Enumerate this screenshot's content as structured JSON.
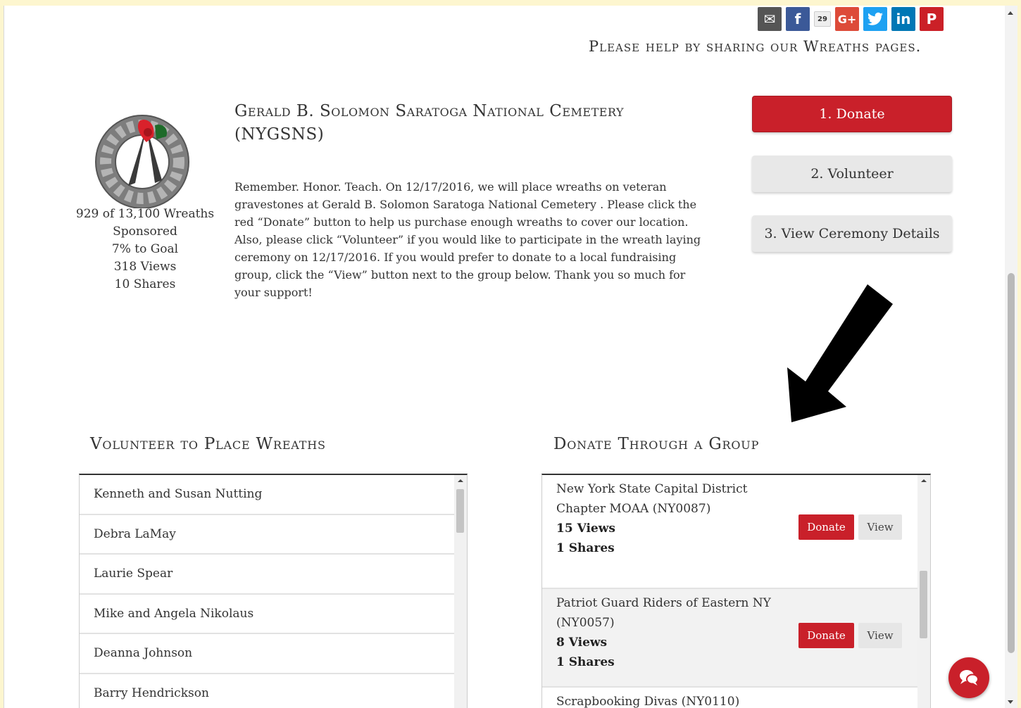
{
  "share": {
    "icons": [
      "mail-icon",
      "facebook-icon",
      "share-count",
      "google-plus-icon",
      "twitter-icon",
      "linkedin-icon",
      "pinterest-icon"
    ],
    "count": "29",
    "message": "Please help by sharing our Wreaths pages."
  },
  "cemetery": {
    "title": "Gerald B. Solomon Saratoga National Cemetery (NYGSNS)",
    "description": "Remember. Honor. Teach. On 12/17/2016, we will place wreaths on veteran gravestones at Gerald B. Solomon Saratoga National Cemetery . Please click the red “Donate” button to help us purchase enough wreaths to cover our location. Also, please click “Volunteer” if you would like to participate in the wreath laying ceremony on 12/17/2016. If you would prefer to donate to a local fundraising group, click the “View” button next to the group below. Thank you so much for your support!"
  },
  "stats": {
    "wreaths": "929 of 13,100 Wreaths",
    "sponsored": "Sponsored",
    "goal": "7% to Goal",
    "views": "318 Views",
    "shares": "10 Shares"
  },
  "actions": {
    "donate": "1. Donate",
    "volunteer": "2. Volunteer",
    "ceremony": "3. View Ceremony Details"
  },
  "volunteer_section": {
    "title": "Volunteer to Place Wreaths",
    "items": [
      "Kenneth and Susan Nutting",
      "Debra LaMay",
      "Laurie Spear",
      "Mike and Angela Nikolaus",
      "Deanna Johnson",
      "Barry Hendrickson"
    ]
  },
  "group_section": {
    "title": "Donate Through a Group",
    "donate_label": "Donate",
    "view_label": "View",
    "groups": [
      {
        "name": "New York State Capital District Chapter MOAA (NY0087)",
        "views": "15 Views",
        "shares": "1 Shares"
      },
      {
        "name": "Patriot Guard Riders of Eastern NY (NY0057)",
        "views": "8 Views",
        "shares": "1 Shares"
      },
      {
        "name": "Scrapbooking Divas (NY0110)"
      }
    ]
  },
  "colors": {
    "accent_red": "#c9202a",
    "frame_yellow": "#fdf6cf"
  }
}
